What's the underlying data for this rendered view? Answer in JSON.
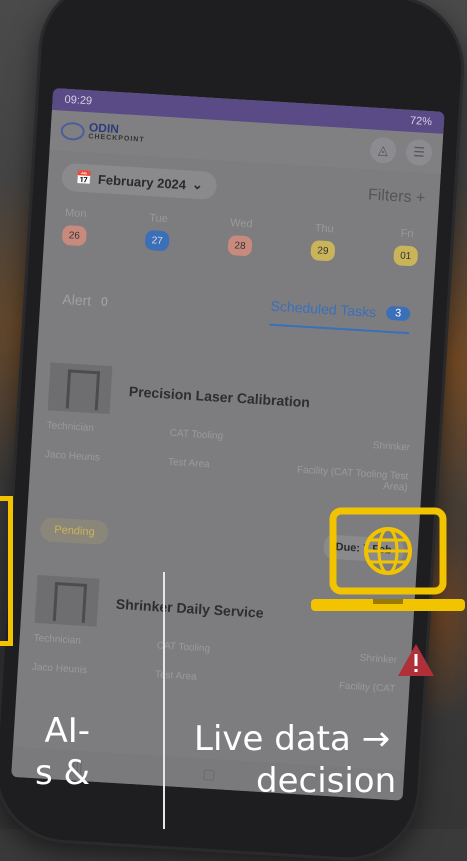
{
  "status_bar": {
    "time": "09:29",
    "battery": "72%"
  },
  "app": {
    "logo_text": "ODIN",
    "logo_sub": "CHECKPOINT"
  },
  "date_picker": {
    "label": "February 2024"
  },
  "filters_label": "Filters +",
  "days": [
    {
      "name": "Mon",
      "num": "26",
      "color": "#c98a7e"
    },
    {
      "name": "Tue",
      "num": "27",
      "color": "#3b6fb8"
    },
    {
      "name": "Wed",
      "num": "28",
      "color": "#c98a7e"
    },
    {
      "name": "Thu",
      "num": "29",
      "color": "#c9b45a"
    },
    {
      "name": "Fri",
      "num": "01",
      "color": "#c9b45a"
    }
  ],
  "tabs": {
    "alert_label": "Alert",
    "alert_count": "0",
    "tasks_label": "Scheduled Tasks",
    "tasks_count": "3"
  },
  "task1": {
    "title": "Precision Laser Calibration",
    "role": "Technician",
    "location": "CAT Tooling",
    "machine": "Shrinker",
    "person": "Jaco Heunis",
    "area": "Test Area",
    "facility": "Facility (CAT Tooling Test Area)",
    "status": "Pending",
    "due": "Due: 7 Feb"
  },
  "task2": {
    "title": "Shrinker Daily Service",
    "role": "Technician",
    "location": "CAT Tooling",
    "machine": "Shrinker",
    "person": "Jaco Heunis",
    "area": "Test Area",
    "facility": "Facility (CAT"
  },
  "captions": {
    "left_line1": "AI-",
    "left_line2": "s &",
    "right_line1": "Live data →",
    "right_line2": "decision"
  },
  "accent": "#f2c400"
}
